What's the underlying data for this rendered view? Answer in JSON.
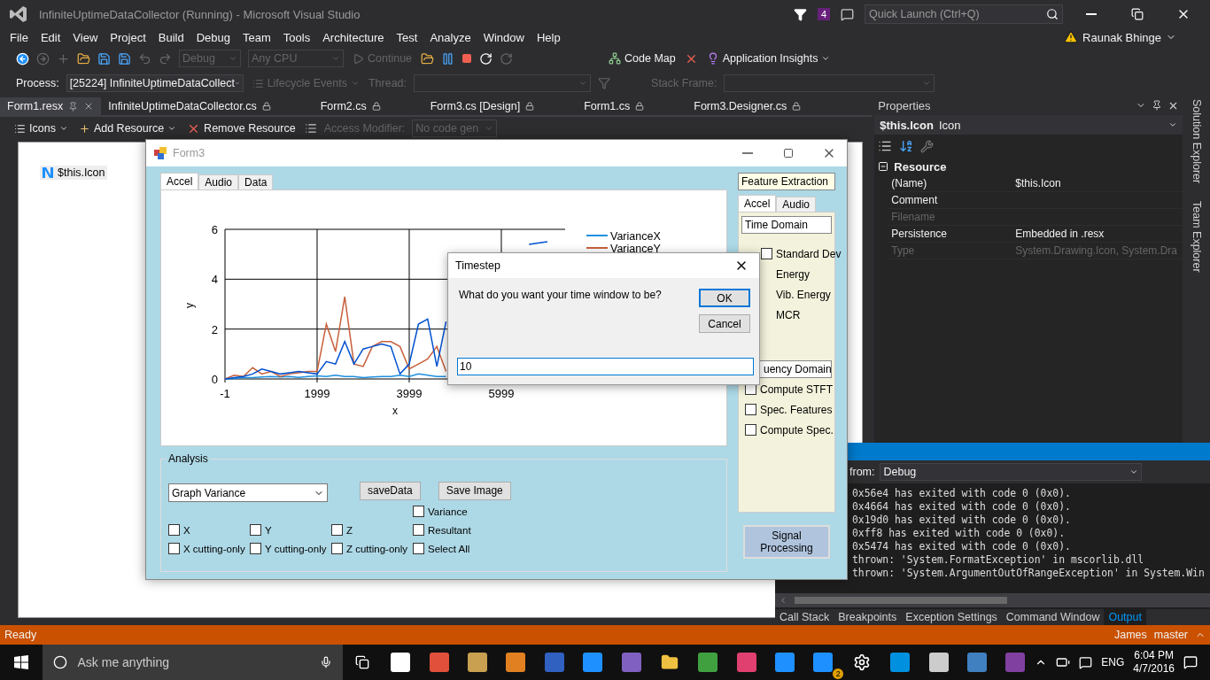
{
  "window": {
    "title": "InfiniteUptimeDataCollector (Running) - Microsoft Visual Studio",
    "notification_count": "4",
    "quick_launch": {
      "placeholder": "Quick Launch (Ctrl+Q)"
    }
  },
  "menu": [
    "File",
    "Edit",
    "View",
    "Project",
    "Build",
    "Debug",
    "Team",
    "Tools",
    "Architecture",
    "Test",
    "Analyze",
    "Window",
    "Help"
  ],
  "user": "Raunak Bhinge",
  "toolbar": {
    "configuration": "Debug",
    "platform": "Any CPU",
    "continue": "Continue",
    "code_map": "Code Map",
    "insights": "Application Insights"
  },
  "debug_location": {
    "process_label": "Process:",
    "process": "[25224] InfiniteUptimeDataCollect",
    "lifecycle": "Lifecycle Events",
    "thread_label": "Thread:",
    "stack_label": "Stack Frame:"
  },
  "document_tabs": [
    {
      "label": "Form1.resx",
      "selected": true
    },
    {
      "label": "InfiniteUptimeDataCollector.cs",
      "selected": false
    },
    {
      "label": "Form2.cs",
      "selected": false
    },
    {
      "label": "Form3.cs [Design]",
      "selected": false
    },
    {
      "label": "Form1.cs",
      "selected": false
    },
    {
      "label": "Form3.Designer.cs",
      "selected": false
    }
  ],
  "resource_toolbar": {
    "view": "Icons",
    "add": "Add Resource",
    "remove": "Remove Resource",
    "access_label": "Access Modifier:",
    "access": "No code gen"
  },
  "resources": [
    "$this.Icon"
  ],
  "form3": {
    "title": "Form3",
    "tabs": [
      {
        "label": "Accel",
        "selected": true
      },
      {
        "label": "Audio",
        "selected": false
      },
      {
        "label": "Data",
        "selected": false
      }
    ],
    "chart_data": {
      "type": "line",
      "xlabel": "x",
      "ylabel": "y",
      "xlim": [
        -1,
        7384
      ],
      "ylim": [
        0,
        6
      ],
      "xticks": [
        -1,
        1999,
        3999,
        5999
      ],
      "yticks": [
        0,
        2,
        4,
        6
      ],
      "grid": true,
      "legend": true,
      "x": [
        -1,
        199,
        399,
        599,
        799,
        999,
        1199,
        1399,
        1599,
        1799,
        1999,
        2199,
        2399,
        2599,
        2799,
        2999,
        3199,
        3399,
        3599,
        3799,
        3999,
        4199,
        4399,
        4599,
        4799,
        6599,
        6999
      ],
      "series": [
        {
          "name": "VarianceX",
          "color": "#1e90e0",
          "values": [
            0,
            0.02,
            0.05,
            0.05,
            0.08,
            0.1,
            0.08,
            0.1,
            0.06,
            0.1,
            0.12,
            0.1,
            0.15,
            0.1,
            0.1,
            0.05,
            0.08,
            0.1,
            0.1,
            0.15,
            0.1,
            0.2,
            0.15,
            0.1,
            0.1,
            null,
            null
          ]
        },
        {
          "name": "VarianceY",
          "color": "#c8603c",
          "values": [
            0,
            0.15,
            0.1,
            0.45,
            0.2,
            0.3,
            0.1,
            0.2,
            0.25,
            0.3,
            0.3,
            2.2,
            1.1,
            3.3,
            0.6,
            0.5,
            1.3,
            1.5,
            1.5,
            1.3,
            0.4,
            0.6,
            0.8,
            1.3,
            0.3,
            null,
            null
          ]
        },
        {
          "color": "#0050d0",
          "values": [
            0,
            0.05,
            0.1,
            0.2,
            0.4,
            0.3,
            0.2,
            0.25,
            0.3,
            0.25,
            0.2,
            0.7,
            0.6,
            1.5,
            0.6,
            1.2,
            1.3,
            1.4,
            1.3,
            0.2,
            0.6,
            2.2,
            2.4,
            0.5,
            2.3,
            5.4,
            5.5
          ]
        }
      ]
    },
    "analysis": {
      "title": "Analysis",
      "graph": "Graph Variance",
      "buttons": [
        "saveData",
        "Save Image"
      ],
      "checkboxes": [
        {
          "label": "Variance",
          "checked": false
        },
        {
          "label": "X",
          "checked": false
        },
        {
          "label": "Y",
          "checked": false
        },
        {
          "label": "Z",
          "checked": false
        },
        {
          "label": "Resultant",
          "checked": false
        },
        {
          "label": "X cutting-only",
          "checked": false
        },
        {
          "label": "Y cutting-only",
          "checked": false
        },
        {
          "label": "Z cutting-only",
          "checked": false
        },
        {
          "label": "Select All",
          "checked": false
        }
      ]
    },
    "feature_extraction": "Feature Extraction",
    "feature_tabs": [
      {
        "label": "Accel",
        "selected": true
      },
      {
        "label": "Audio",
        "selected": false
      }
    ],
    "time_domain": "Time Domain",
    "time_features": [
      {
        "label": "Standard Dev",
        "checked": false
      },
      {
        "label": "Energy"
      },
      {
        "label": "Vib. Energy"
      },
      {
        "label": "MCR"
      }
    ],
    "frequency_domain": "uency Domain",
    "frequency_features": [
      {
        "label": "Compute STFT",
        "checked": false
      },
      {
        "label": "Spec. Features",
        "checked": false
      },
      {
        "label": "Compute Spec.",
        "checked": false
      }
    ],
    "signal_button": "Signal Processing"
  },
  "dialog": {
    "title": "Timestep",
    "prompt": "What do you want your time window to be?",
    "ok": "OK",
    "cancel": "Cancel",
    "value": "10"
  },
  "properties": {
    "title": "Properties",
    "object": "$this.Icon",
    "object_type": "Icon",
    "category": "Resource",
    "expanded": true,
    "rows": [
      {
        "name": "(Name)",
        "value": "$this.Icon",
        "disabled": false
      },
      {
        "name": "Comment",
        "disabled": false
      },
      {
        "name": "Filename",
        "disabled": true
      },
      {
        "name": "Persistence",
        "value": "Embedded in .resx",
        "disabled": false
      },
      {
        "name": "Type",
        "value": "System.Drawing.Icon, System.Dra",
        "disabled": true
      }
    ]
  },
  "side_tabs": [
    "Solution Explorer",
    "Team Explorer"
  ],
  "output": {
    "source_label": "from:",
    "source": "Debug",
    "lines": [
      "0x56e4 has exited with code 0 (0x0).",
      "0x4664 has exited with code 0 (0x0).",
      "0x19d0 has exited with code 0 (0x0).",
      "0xff8 has exited with code 0 (0x0).",
      "0x5474 has exited with code 0 (0x0).",
      "thrown: 'System.FormatException' in mscorlib.dll",
      "thrown: 'System.ArgumentOutOfRangeException' in System.Win"
    ],
    "tabs": [
      {
        "label": "Call Stack",
        "selected": false
      },
      {
        "label": "Breakpoints",
        "selected": false
      },
      {
        "label": "Exception Settings",
        "selected": false
      },
      {
        "label": "Command Window",
        "selected": false
      },
      {
        "label": "Output",
        "selected": true
      }
    ]
  },
  "status_bar": {
    "text": "Ready",
    "user": "James",
    "branch": "master"
  },
  "taskbar": {
    "search": {
      "placeholder": "Ask me anything"
    },
    "badge": "2",
    "language": "ENG",
    "time": "6:04 PM",
    "date": "4/7/2016"
  }
}
